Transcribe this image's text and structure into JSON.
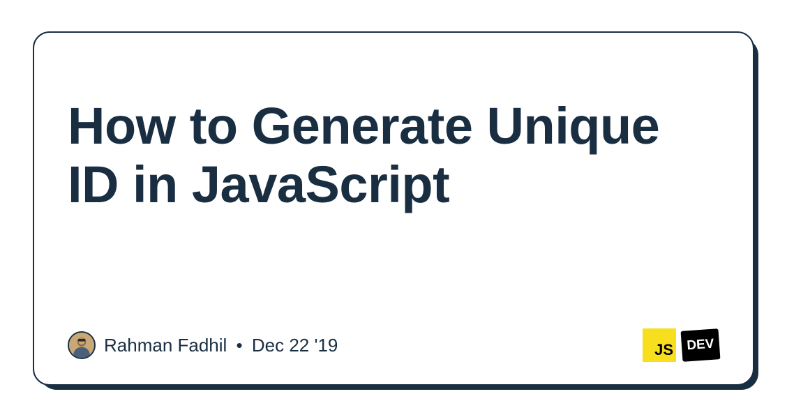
{
  "title": "How to Generate Unique ID in JavaScript",
  "author": {
    "name": "Rahman Fadhil",
    "date": "Dec 22 '19"
  },
  "badges": {
    "js": "JS",
    "dev": "DEV"
  },
  "colors": {
    "primary": "#1a2e42",
    "jsYellow": "#f7df1e",
    "devBlack": "#000000"
  }
}
